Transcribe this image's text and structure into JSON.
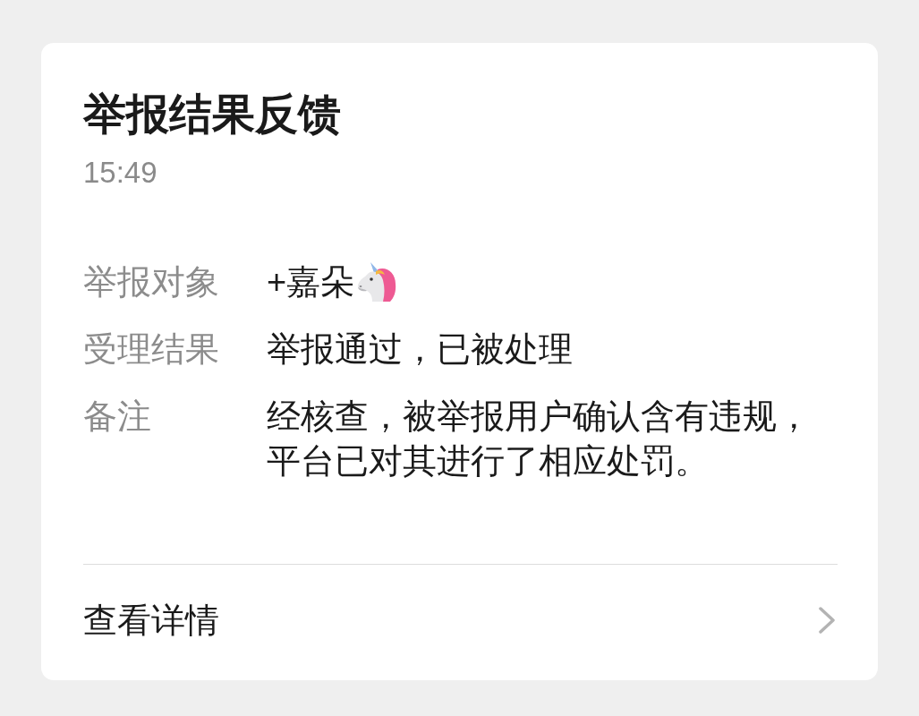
{
  "card": {
    "title": "举报结果反馈",
    "time": "15:49",
    "fields": [
      {
        "label": "举报对象",
        "value": "+嘉朵",
        "kind": "user"
      },
      {
        "label": "受理结果",
        "value": "举报通过，已被处理",
        "kind": "text"
      },
      {
        "label": "备注",
        "value": "经核查，被举报用户确认含有违规，平台已对其进行了相应处罚。",
        "kind": "text"
      }
    ],
    "footer": {
      "label": "查看详情"
    }
  }
}
